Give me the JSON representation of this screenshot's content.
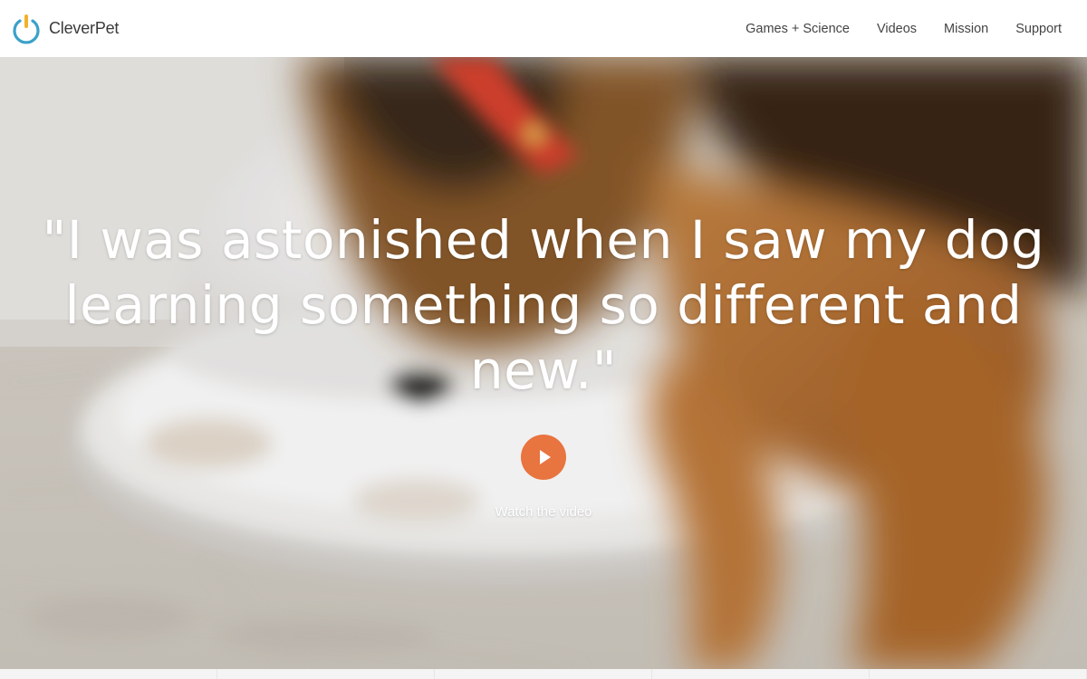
{
  "header": {
    "brand_name": "CleverPet",
    "logo_icon": "power-button-logo-icon",
    "nav": [
      {
        "label": "Games + Science"
      },
      {
        "label": "Videos"
      },
      {
        "label": "Mission"
      },
      {
        "label": "Support"
      }
    ]
  },
  "hero": {
    "quote": "\"I was astonished when I saw my dog learning something so different and new.\"",
    "play_icon": "play-icon",
    "cta_label": "Watch the video"
  },
  "colors": {
    "accent": "#e8743f",
    "logo_ring": "#3aa1c9",
    "logo_bar": "#f2b12b",
    "text_dark": "#444444"
  }
}
